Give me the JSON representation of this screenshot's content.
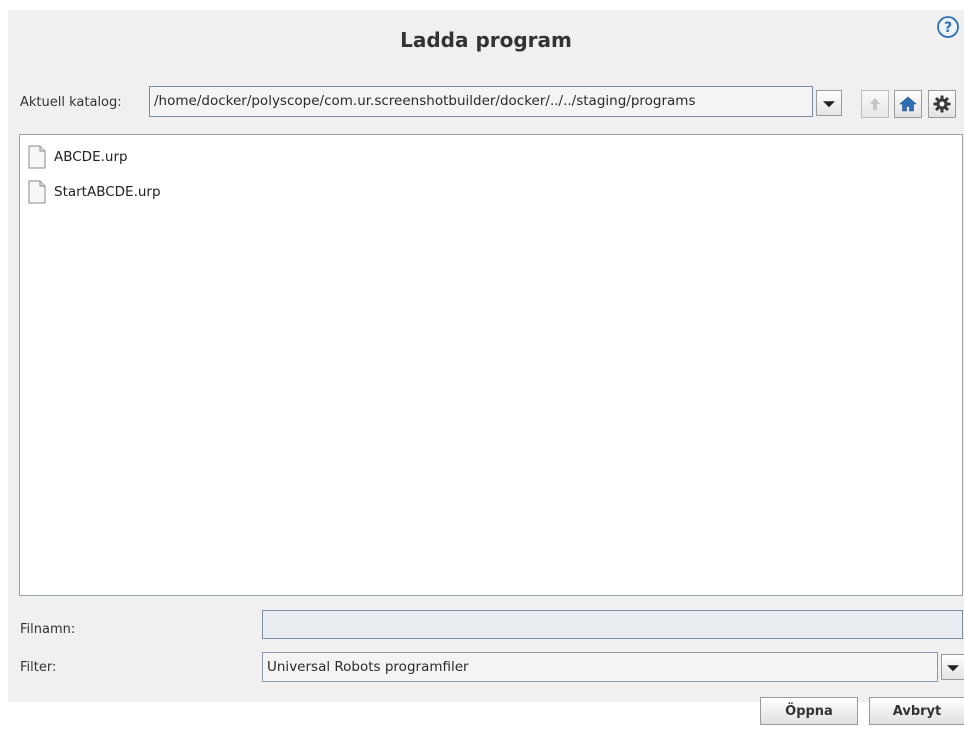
{
  "dialog": {
    "title": "Ladda program"
  },
  "directory": {
    "label": "Aktuell katalog:",
    "path": "/home/docker/polyscope/com.ur.screenshotbuilder/docker/../../staging/programs"
  },
  "toolbar": {
    "icons": [
      "arrow-up-icon",
      "home-icon",
      "gear-icon"
    ],
    "accent": "#2f6fb8"
  },
  "files": [
    {
      "name": "ABCDE.urp"
    },
    {
      "name": "StartABCDE.urp"
    }
  ],
  "filename": {
    "label": "Filnamn:",
    "value": ""
  },
  "filter": {
    "label": "Filter:",
    "selected": "Universal Robots programfiler"
  },
  "buttons": {
    "open": "Öppna",
    "cancel": "Avbryt"
  }
}
